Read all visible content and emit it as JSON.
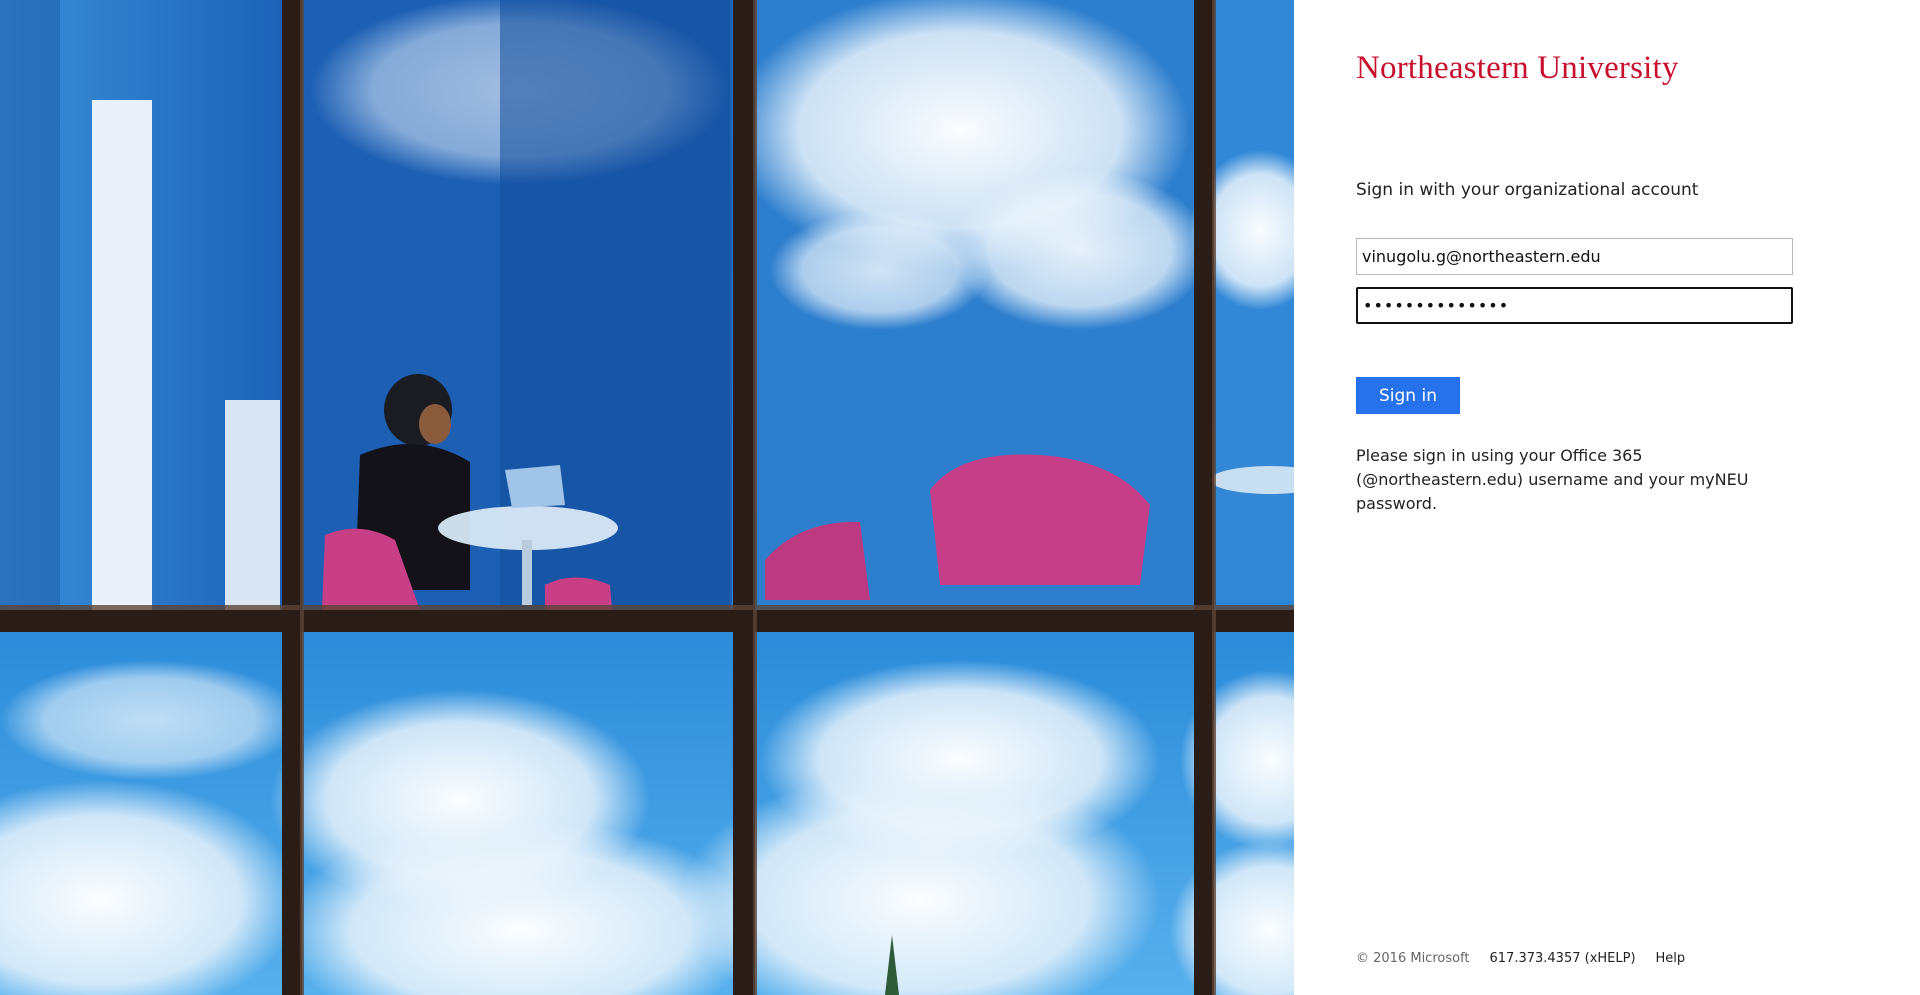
{
  "illustration": {
    "alt": "Office worker at a laptop behind reflective glass windows with a cloudy blue sky"
  },
  "brand": {
    "logo_text": "Northeastern University",
    "logo_color": "#c8102e"
  },
  "form": {
    "prompt": "Sign in with your organizational account",
    "username_value": "vinugolu.g@northeastern.edu",
    "password_value": "••••••••••••••",
    "submit_label": "Sign in",
    "submit_color": "#2672ec",
    "help_note": "Please sign in using your Office 365 (@northeastern.edu) username and your myNEU password."
  },
  "footer": {
    "copyright": "© 2016 Microsoft",
    "phone": "617.373.4357 (xHELP)",
    "help_link": "Help"
  }
}
